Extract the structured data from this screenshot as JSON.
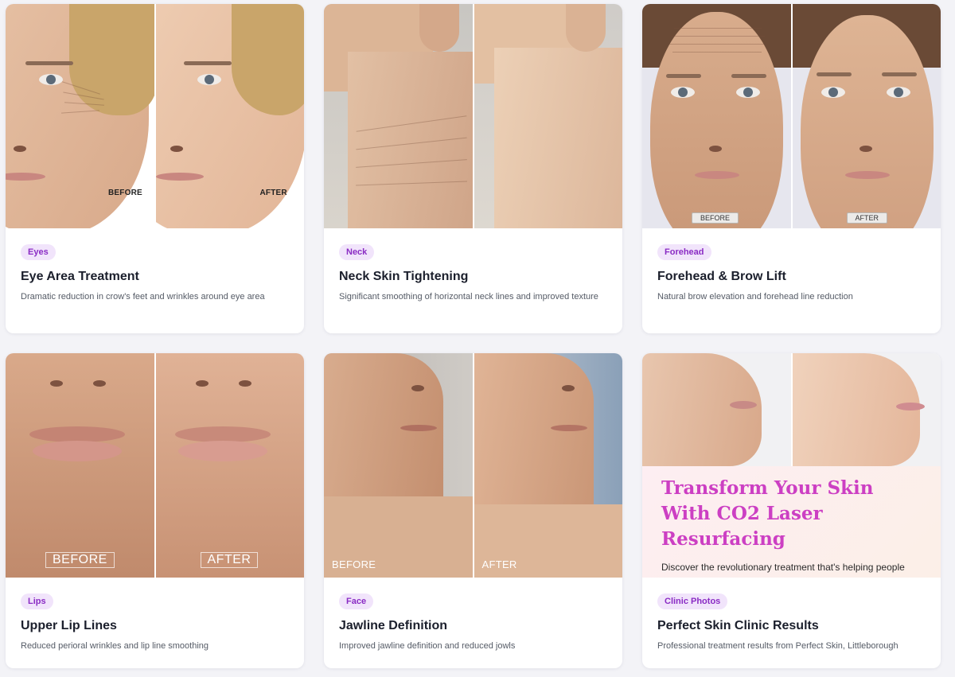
{
  "labels": {
    "before": "BEFORE",
    "after": "AFTER"
  },
  "cards": [
    {
      "tag": "Eyes",
      "title": "Eye Area Treatment",
      "description": "Dramatic reduction in crow's feet and wrinkles around eye area"
    },
    {
      "tag": "Neck",
      "title": "Neck Skin Tightening",
      "description": "Significant smoothing of horizontal neck lines and improved texture"
    },
    {
      "tag": "Forehead",
      "title": "Forehead & Brow Lift",
      "description": "Natural brow elevation and forehead line reduction"
    },
    {
      "tag": "Lips",
      "title": "Upper Lip Lines",
      "description": "Reduced perioral wrinkles and lip line smoothing"
    },
    {
      "tag": "Face",
      "title": "Jawline Definition",
      "description": "Improved jawline definition and reduced jowls"
    },
    {
      "tag": "Clinic Photos",
      "title": "Perfect Skin Clinic Results",
      "description": "Professional treatment results from Perfect Skin, Littleborough"
    }
  ],
  "promo": {
    "heading": "Transform Your Skin With CO2 Laser Resurfacing",
    "text": "Discover the revolutionary treatment that's helping people"
  },
  "colors": {
    "tag_bg": "#f1e4fb",
    "tag_text": "#8a2bc4",
    "promo_heading": "#cc3fc3",
    "page_bg": "#f3f3f7"
  }
}
